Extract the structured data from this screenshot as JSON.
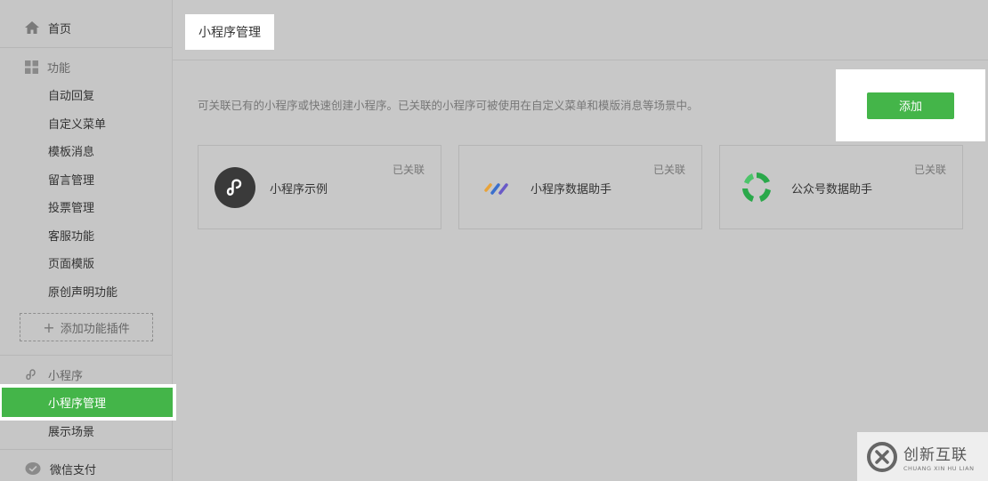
{
  "sidebar": {
    "home_label": "首页",
    "function_section": {
      "label": "功能",
      "items": [
        "自动回复",
        "自定义菜单",
        "模板消息",
        "留言管理",
        "投票管理",
        "客服功能",
        "页面模版",
        "原创声明功能"
      ]
    },
    "add_plugin_label": "添加功能插件",
    "miniprogram_section": {
      "label": "小程序",
      "items": [
        "小程序管理",
        "展示场景"
      ],
      "active_index": 0
    },
    "wechat_pay_label": "微信支付"
  },
  "header": {
    "tab_title": "小程序管理"
  },
  "main": {
    "description": "可关联已有的小程序或快速创建小程序。已关联的小程序可被使用在自定义菜单和模版消息等场景中。",
    "add_button_label": "添加",
    "cards": [
      {
        "name": "小程序示例",
        "status": "已关联",
        "icon": "miniprogram-link-icon"
      },
      {
        "name": "小程序数据助手",
        "status": "已关联",
        "icon": "data-assistant-icon"
      },
      {
        "name": "公众号数据助手",
        "status": "已关联",
        "icon": "green-cycle-icon"
      }
    ]
  },
  "watermark": {
    "cn": "创新互联",
    "en": "CHUANG XIN HU LIAN"
  },
  "colors": {
    "accent": "#44b549",
    "background": "#c8c8c8"
  }
}
